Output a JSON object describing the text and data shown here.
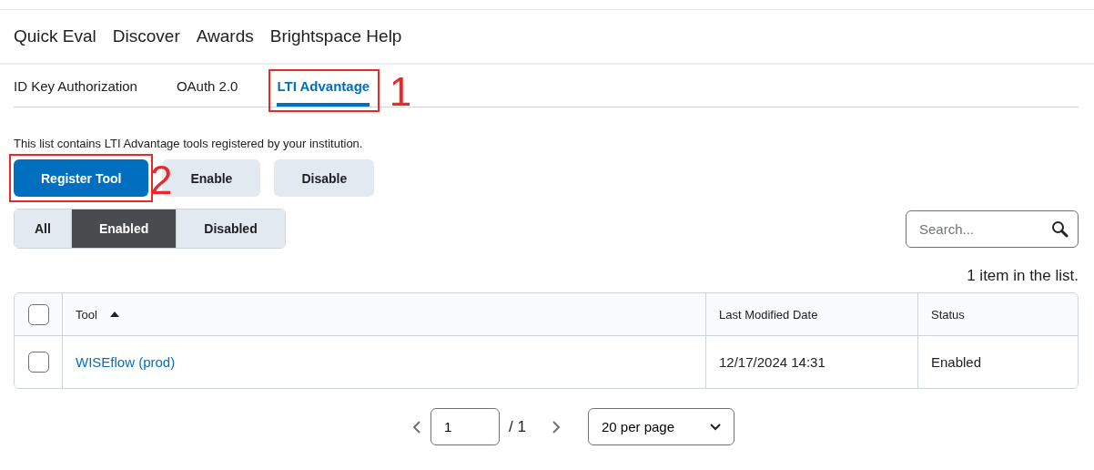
{
  "nav": {
    "items": [
      "Quick Eval",
      "Discover",
      "Awards",
      "Brightspace Help"
    ]
  },
  "tabs": [
    {
      "label": "ID Key Authorization",
      "selected": false
    },
    {
      "label": "OAuth 2.0",
      "selected": false
    },
    {
      "label": "LTI Advantage",
      "selected": true,
      "step": "1"
    }
  ],
  "description": "This list contains LTI Advantage tools registered by your institution.",
  "actions": [
    {
      "label": "Register Tool",
      "kind": "primary",
      "step": "2"
    },
    {
      "label": "Enable",
      "kind": "secondary"
    },
    {
      "label": "Disable",
      "kind": "secondary"
    }
  ],
  "filters": [
    {
      "label": "All",
      "selected": false
    },
    {
      "label": "Enabled",
      "selected": true
    },
    {
      "label": "Disabled",
      "selected": false
    }
  ],
  "search": {
    "placeholder": "Search..."
  },
  "count": "1 item in the list.",
  "table": {
    "columns": [
      "Tool",
      "Last Modified Date",
      "Status"
    ],
    "select_all_checked": false,
    "rows": [
      {
        "tool": "WISEflow (prod)",
        "date": "12/17/2024 14:31",
        "status": "Enabled",
        "checked": false
      }
    ]
  },
  "pagination": {
    "page": "1",
    "total": "/ 1",
    "per_page": "20 per page"
  }
}
